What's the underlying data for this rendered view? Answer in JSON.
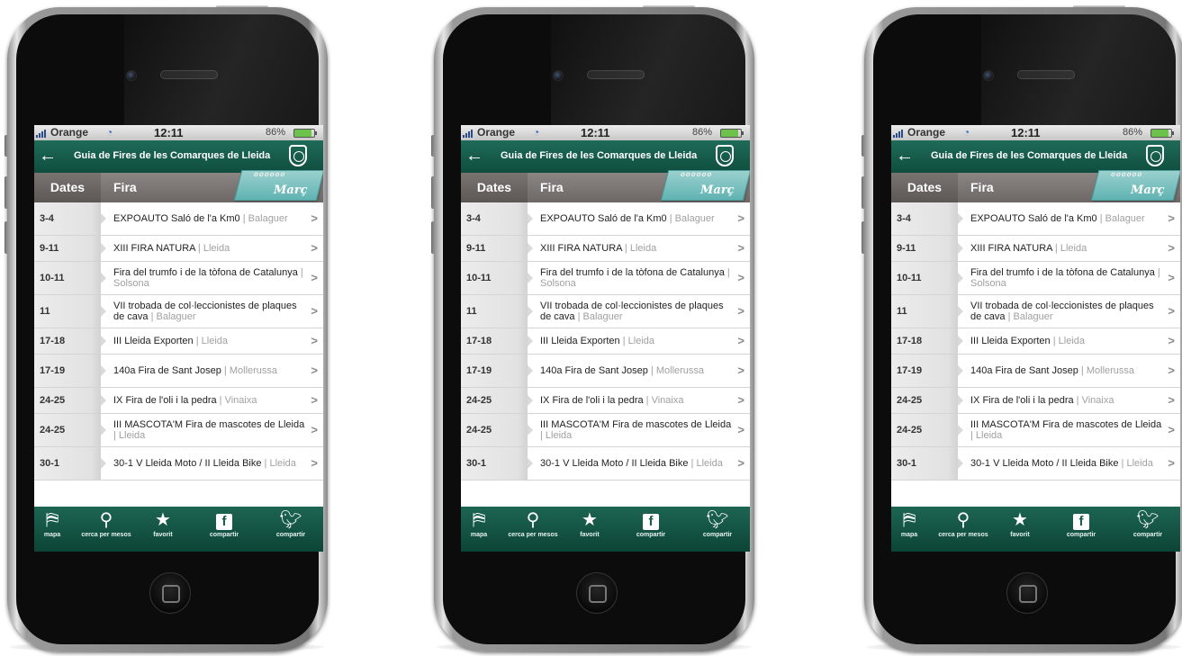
{
  "status_bar": {
    "carrier": "Orange",
    "time": "12:11",
    "battery": "86%"
  },
  "nav": {
    "back_icon": "←",
    "title": "Guia de Fires de les Comarques de Lleida"
  },
  "header": {
    "dates_label": "Dates",
    "fira_label": "Fira",
    "month": "Març"
  },
  "events": [
    {
      "date": "3-4",
      "name": "EXPOAUTO Saló de l'a Km0",
      "sep": " | ",
      "location": "Balaguer"
    },
    {
      "date": "9-11",
      "name": "XIII FIRA NATURA",
      "sep": " | ",
      "location": "Lleida"
    },
    {
      "date": "10-11",
      "name": "Fira del trumfo i de la tòfona de Catalunya",
      "sep": " | ",
      "location": "Solsona"
    },
    {
      "date": "11",
      "name": "VII trobada de col·leccionistes de plaques de cava",
      "sep": " | ",
      "location": "Balaguer"
    },
    {
      "date": "17-18",
      "name": "III Lleida Exporten",
      "sep": " | ",
      "location": "Lleida"
    },
    {
      "date": "17-19",
      "name": "140a Fira de Sant Josep",
      "sep": " | ",
      "location": "Mollerussa"
    },
    {
      "date": "24-25",
      "name": "IX Fira de l'oli i la pedra",
      "sep": " | ",
      "location": "Vinaixa"
    },
    {
      "date": "24-25",
      "name": "III MASCOTA'M Fira de mascotes de Lleida",
      "sep": " | ",
      "location": "Lleida"
    },
    {
      "date": "30-1",
      "name": "30-1 V Lleida Moto / II Lleida Bike",
      "sep": " | ",
      "location": "Lleida"
    }
  ],
  "tabbar": {
    "map": "mapa",
    "search": "cerca per mesos",
    "favorite": "favorit",
    "share_facebook": "compartir",
    "share_twitter": "compartir"
  },
  "icons": {
    "map": "map-icon",
    "search": "search-icon",
    "favorite": "star-icon",
    "facebook": "facebook-icon",
    "twitter": "twitter-icon",
    "chevron": "chevron-right-icon",
    "back": "back-arrow-icon",
    "shield": "coat-of-arms-icon"
  },
  "colors": {
    "navbar": "#1f6a58",
    "tabbar": "#0c4436",
    "header": "#7a7471",
    "month_tab": "#5fb3b2",
    "location_text": "#a0a0a0"
  }
}
